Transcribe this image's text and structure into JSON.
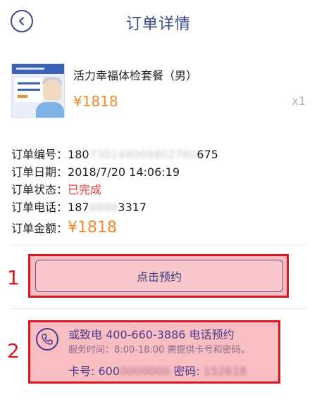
{
  "header": {
    "title": "订单详情",
    "back_icon": "chevron-left-icon"
  },
  "product": {
    "name": "活力幸福体检套餐（男）",
    "price": "¥1818",
    "quantity": "x1"
  },
  "order": {
    "number_label": "订单编号：",
    "number_prefix": "180",
    "number_hidden": "730148069802760",
    "number_suffix": "675",
    "date_label": "订单日期：",
    "date_value": "2018/7/20 14:06:19",
    "status_label": "订单状态：",
    "status_value": "已完成",
    "phone_label": "订单电话：",
    "phone_prefix": "187",
    "phone_hidden": "8888",
    "phone_suffix": "3317",
    "amount_label": "订单金额：",
    "amount_value": "¥1818"
  },
  "annotations": {
    "marker_1": "1",
    "marker_2": "2"
  },
  "booking": {
    "button_label": "点击预约"
  },
  "phone_booking": {
    "title": "或致电 400-660-3886 电话预约",
    "hours": "服务时间：8:00-18:00 需提供卡号和密码。",
    "card_label": "卡号: ",
    "card_prefix": "600",
    "card_hidden": "0000000",
    "password_label": " 密码: ",
    "password_hidden": "152618"
  },
  "colors": {
    "accent": "#3a4a8c",
    "price": "#f08a2c",
    "status_done": "#e03b3b",
    "highlight_border": "#e0141c"
  }
}
